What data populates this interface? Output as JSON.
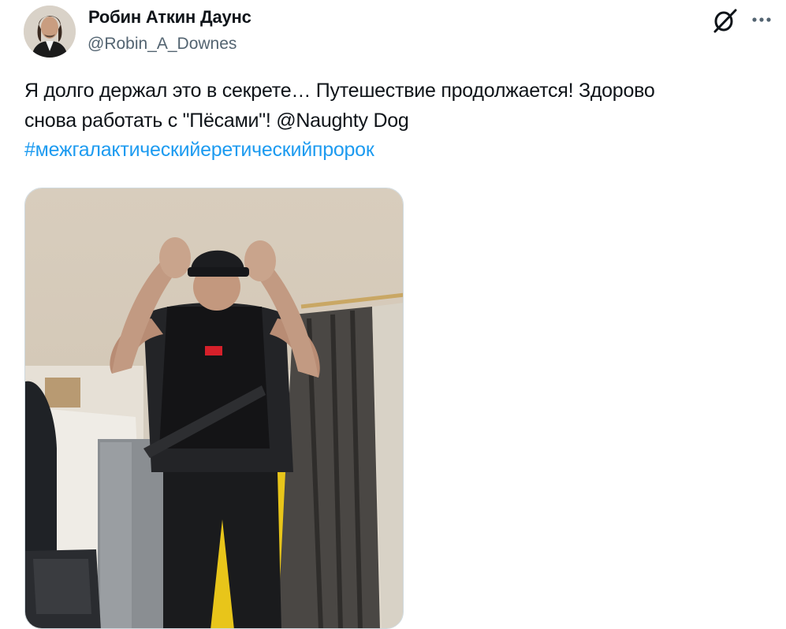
{
  "author": {
    "display_name": "Робин Аткин Даунс",
    "handle": "@Robin_A_Downes"
  },
  "header_icons": {
    "brand": "xai-grok-icon",
    "more": "more-dots-icon"
  },
  "tweet": {
    "line1": "Я долго держал это в секрете… Путешествие продолжается! Здорово",
    "line2": "снова работать с \"Пёсами\"! @Naughty Dog",
    "hashtag": "#межгалактическийеретическийпророк"
  },
  "media": {
    "kind": "video-thumbnail"
  },
  "colors": {
    "link": "#1d9bf0",
    "secondary_text": "#536471",
    "primary_text": "#0f1419"
  }
}
